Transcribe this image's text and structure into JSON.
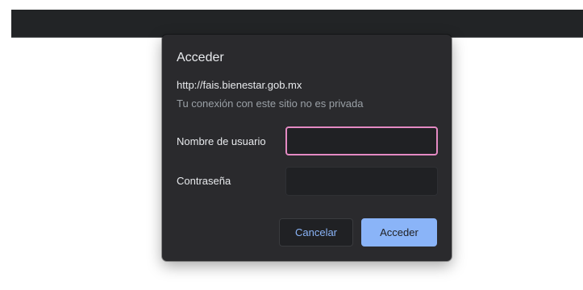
{
  "dialog": {
    "title": "Acceder",
    "url": "http://fais.bienestar.gob.mx",
    "warning": "Tu conexión con este sitio no es privada",
    "username_label": "Nombre de usuario",
    "username_value": "",
    "password_label": "Contraseña",
    "password_value": "",
    "cancel_label": "Cancelar",
    "accept_label": "Acceder"
  },
  "colors": {
    "dialog_bg": "#2a2a2d",
    "accent": "#8ab4f8",
    "focus_border": "#e48ac3",
    "topbar": "#222426"
  }
}
